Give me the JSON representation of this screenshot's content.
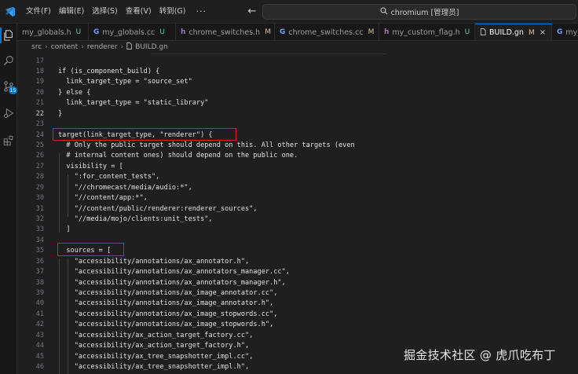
{
  "titlebar": {
    "menu": [
      "文件(F)",
      "编辑(E)",
      "选择(S)",
      "查看(V)",
      "转到(G)"
    ],
    "more": "···",
    "back_arrow": "←",
    "forward_arrow": "→",
    "command_center": "chromium [管理员]"
  },
  "activity_bar": {
    "icons": [
      "explorer-icon",
      "search-icon",
      "source-control-icon",
      "run-debug-icon",
      "extensions-icon"
    ],
    "scm_badge": "15"
  },
  "tabs": [
    {
      "label": "my_globals.h",
      "type": "h",
      "status": "U",
      "active": false
    },
    {
      "label": "my_globals.cc",
      "type": "cpp",
      "status": "U",
      "active": false
    },
    {
      "label": "chrome_switches.h",
      "type": "h",
      "status": "M",
      "active": false
    },
    {
      "label": "chrome_switches.cc",
      "type": "cpp",
      "status": "M",
      "active": false
    },
    {
      "label": "my_custom_flag.h",
      "type": "h",
      "status": "U",
      "active": false
    },
    {
      "label": "BUILD.gn",
      "type": "gn",
      "status": "M",
      "active": true
    },
    {
      "label": "my_",
      "type": "cpp",
      "status": "",
      "active": false
    }
  ],
  "breadcrumb": {
    "items": [
      "src",
      "content",
      "renderer"
    ],
    "file": "BUILD.gn"
  },
  "editor": {
    "current_line": 22,
    "lines": [
      {
        "n": "17",
        "text": ""
      },
      {
        "n": "18",
        "text": "if (is_component_build) {"
      },
      {
        "n": "19",
        "text": "  link_target_type = \"source_set\""
      },
      {
        "n": "20",
        "text": "} else {"
      },
      {
        "n": "21",
        "text": "  link_target_type = \"static_library\""
      },
      {
        "n": "22",
        "text": "}"
      },
      {
        "n": "23",
        "text": ""
      },
      {
        "n": "24",
        "text": "target(link_target_type, \"renderer\") {"
      },
      {
        "n": "25",
        "text": "  # Only the public target should depend on this. All other targets (even"
      },
      {
        "n": "26",
        "text": "  # internal content ones) should depend on the public one."
      },
      {
        "n": "27",
        "text": "  visibility = ["
      },
      {
        "n": "28",
        "text": "    \":for_content_tests\","
      },
      {
        "n": "29",
        "text": "    \"//chromecast/media/audio:*\","
      },
      {
        "n": "30",
        "text": "    \"//content/app:*\","
      },
      {
        "n": "31",
        "text": "    \"//content/public/renderer:renderer_sources\","
      },
      {
        "n": "32",
        "text": "    \"//media/mojo/clients:unit_tests\","
      },
      {
        "n": "33",
        "text": "  ]"
      },
      {
        "n": "34",
        "text": ""
      },
      {
        "n": "35",
        "text": "  sources = ["
      },
      {
        "n": "36",
        "text": "    \"accessibility/annotations/ax_annotator.h\","
      },
      {
        "n": "37",
        "text": "    \"accessibility/annotations/ax_annotators_manager.cc\","
      },
      {
        "n": "38",
        "text": "    \"accessibility/annotations/ax_annotators_manager.h\","
      },
      {
        "n": "39",
        "text": "    \"accessibility/annotations/ax_image_annotator.cc\","
      },
      {
        "n": "40",
        "text": "    \"accessibility/annotations/ax_image_annotator.h\","
      },
      {
        "n": "41",
        "text": "    \"accessibility/annotations/ax_image_stopwords.cc\","
      },
      {
        "n": "42",
        "text": "    \"accessibility/annotations/ax_image_stopwords.h\","
      },
      {
        "n": "43",
        "text": "    \"accessibility/ax_action_target_factory.cc\","
      },
      {
        "n": "44",
        "text": "    \"accessibility/ax_action_target_factory.h\","
      },
      {
        "n": "45",
        "text": "    \"accessibility/ax_tree_snapshotter_impl.cc\","
      },
      {
        "n": "46",
        "text": "    \"accessibility/ax_tree_snapshotter_impl.h\","
      }
    ]
  },
  "watermark": "掘金技术社区 @ 虎爪吃布丁",
  "colors": {
    "accent": "#0078d4",
    "highlight_box": "#e02020",
    "modified": "#e2c08d",
    "untracked": "#73c991"
  }
}
